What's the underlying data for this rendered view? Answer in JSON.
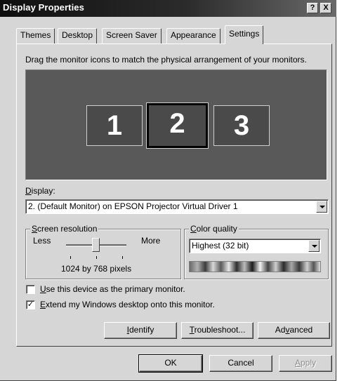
{
  "window": {
    "title": "Display Properties",
    "help_button": "?",
    "close_button": "X"
  },
  "tabs": [
    {
      "label": "Themes",
      "active": false
    },
    {
      "label": "Desktop",
      "active": false
    },
    {
      "label": "Screen Saver",
      "active": false
    },
    {
      "label": "Appearance",
      "active": false
    },
    {
      "label": "Settings",
      "active": true
    }
  ],
  "settings": {
    "instructions": "Drag the monitor icons to match the physical arrangement of your monitors.",
    "monitors": [
      {
        "number": "1",
        "selected": false
      },
      {
        "number": "2",
        "selected": true
      },
      {
        "number": "3",
        "selected": false
      }
    ],
    "display_label_mnemonic": "D",
    "display_label_rest": "isplay:",
    "display_value": "2. (Default Monitor) on EPSON Projector Virtual Driver 1",
    "resolution": {
      "title_mnemonic": "S",
      "title_rest": "creen resolution",
      "less": "Less",
      "more": "More",
      "value_text": "1024 by 768 pixels",
      "slider_fraction": 0.5
    },
    "color_quality": {
      "title_mnemonic": "C",
      "title_rest": "olor quality",
      "value": "Highest (32 bit)"
    },
    "primary_checkbox": {
      "mnemonic": "U",
      "rest": "se this device as the primary monitor.",
      "checked": false
    },
    "extend_checkbox": {
      "mnemonic": "E",
      "rest": "xtend my Windows desktop onto this monitor.",
      "checked": true,
      "check_glyph": "✓"
    },
    "buttons": {
      "identify_mnemonic": "I",
      "identify_rest": "dentify",
      "troubleshoot_mnemonic": "T",
      "troubleshoot_rest": "roubleshoot...",
      "advanced_pre": "Ad",
      "advanced_mnemonic": "v",
      "advanced_rest": "anced"
    }
  },
  "footer": {
    "ok": "OK",
    "cancel": "Cancel",
    "apply_mnemonic": "A",
    "apply_rest": "pply"
  }
}
